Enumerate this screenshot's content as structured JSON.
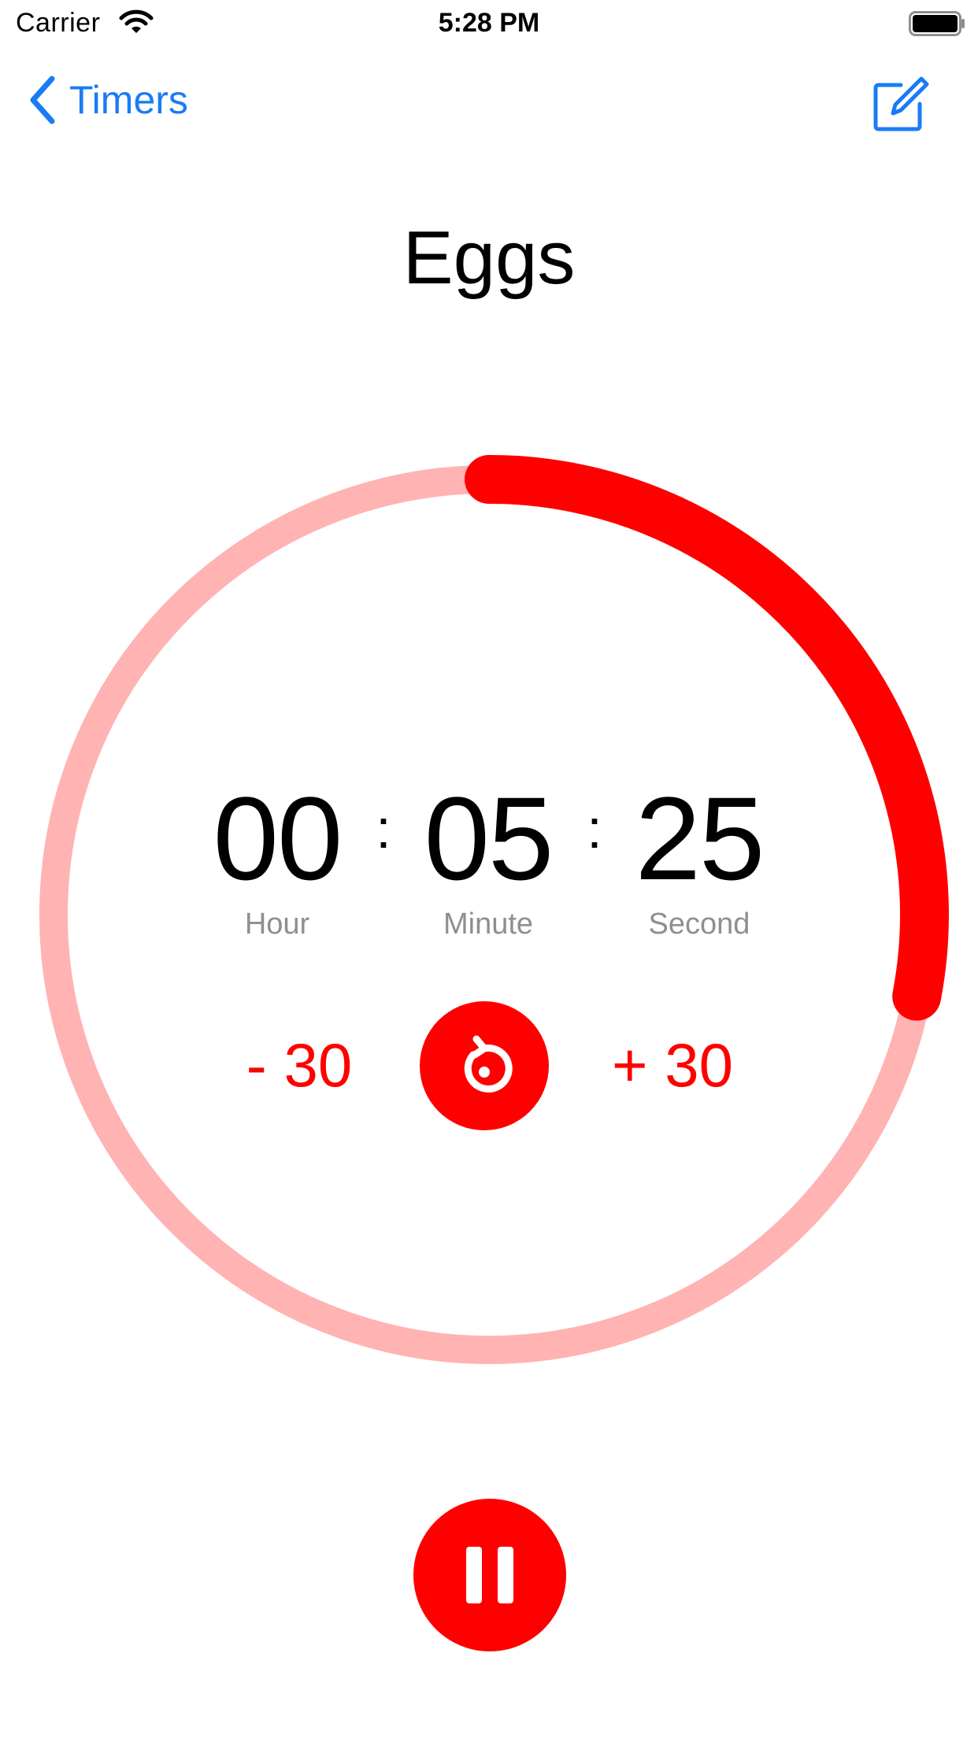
{
  "status_bar": {
    "carrier": "Carrier",
    "time": "5:28 PM"
  },
  "nav": {
    "back_label": "Timers",
    "back_icon": "chevron-left-icon",
    "action_icon": "compose-icon",
    "accent_color": "#1a7cf5"
  },
  "timer": {
    "name": "Eggs",
    "hours": "00",
    "minutes": "05",
    "seconds": "25",
    "separator": ":",
    "hour_label": "Hour",
    "minute_label": "Minute",
    "second_label": "Second",
    "progress_fraction": 0.28,
    "track_color": "#ffb3b3",
    "progress_color": "#ff0000"
  },
  "controls": {
    "minus_label": "- 30",
    "plus_label": "+ 30",
    "reset_icon": "reset-arrow-icon",
    "pause_icon": "pause-icon",
    "control_color": "#ff0000"
  }
}
